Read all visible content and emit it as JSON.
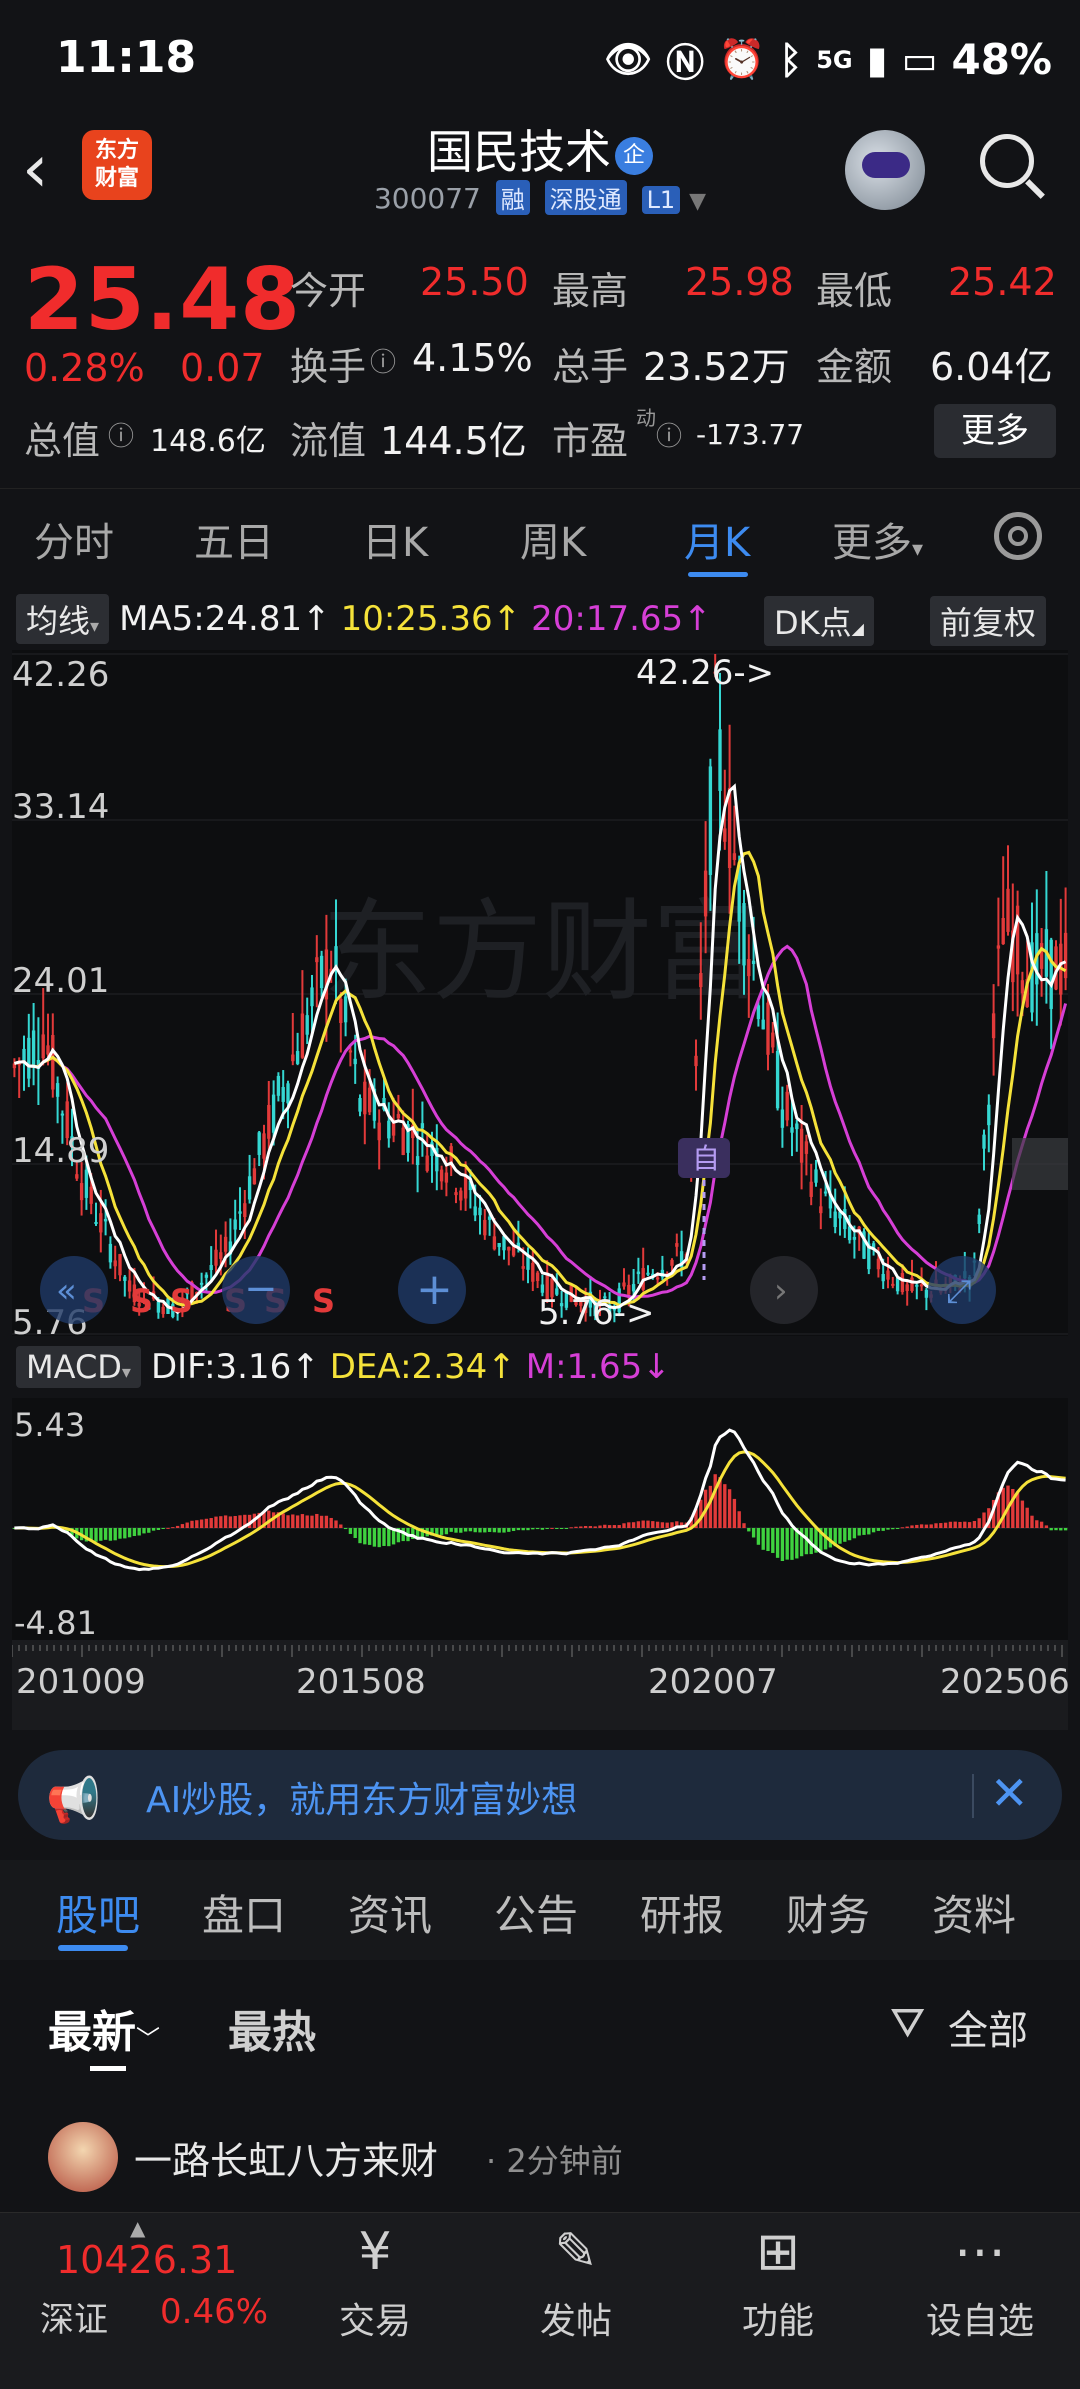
{
  "status_bar": {
    "time": "11:18",
    "network": "5G",
    "battery": "48%"
  },
  "header": {
    "logo_text": "东方财富",
    "stock_name": "国民技术",
    "qi_badge": "企",
    "stock_code": "300077",
    "tags": [
      "融",
      "深股通",
      "L1"
    ]
  },
  "quote": {
    "price": "25.48",
    "change_pct": "0.28%",
    "change": "0.07",
    "fields": [
      {
        "label": "今开",
        "value": "25.50",
        "color": "#f02c2c"
      },
      {
        "label": "最高",
        "value": "25.98",
        "color": "#f02c2c"
      },
      {
        "label": "最低",
        "value": "25.42",
        "color": "#f02c2c"
      },
      {
        "label": "换手",
        "value": "4.15%",
        "color": "#f2f2f2"
      },
      {
        "label": "总手",
        "value": "23.52万",
        "color": "#f2f2f2"
      },
      {
        "label": "金额",
        "value": "6.04亿",
        "color": "#f2f2f2"
      },
      {
        "label": "总值",
        "value": "148.6亿",
        "color": "#f2f2f2"
      },
      {
        "label": "流值",
        "value": "144.5亿",
        "color": "#f2f2f2"
      },
      {
        "label": "市盈",
        "value": "-173.77",
        "color": "#f2f2f2"
      }
    ],
    "pe_suffix": "动",
    "more_label": "更多"
  },
  "period_tabs": [
    "分时",
    "五日",
    "日K",
    "周K",
    "月K",
    "更多"
  ],
  "active_period": "月K",
  "ma_row": {
    "label": "均线",
    "ma5": "MA5:24.81↑",
    "ma10": "10:25.36↑",
    "ma20": "20:17.65↑",
    "dk_label": "DK点",
    "fq_label": "前复权"
  },
  "kline": {
    "y_ticks": [
      "42.26",
      "33.14",
      "24.01",
      "14.89",
      "5.76"
    ],
    "max_label": "42.26->",
    "min_label": "5.76->",
    "self_marker": "自",
    "s_marker": "S",
    "watermark": "东方财富",
    "colors": {
      "up": "#e23a3a",
      "down": "#35d7d2",
      "ma5": "#ffffff",
      "ma10": "#f5e23a",
      "ma20": "#d63fd6"
    }
  },
  "macd": {
    "label": "MACD",
    "dif": "DIF:3.16↑",
    "dea": "DEA:2.34↑",
    "m": "M:1.65↓",
    "y_ticks": [
      "5.43",
      "-4.81"
    ]
  },
  "x_axis": [
    "201009",
    "201508",
    "202007",
    "202506"
  ],
  "ai_banner": "AI炒股，就用东方财富妙想",
  "bottom_tabs": [
    "股吧",
    "盘口",
    "资讯",
    "公告",
    "研报",
    "财务",
    "资料"
  ],
  "filter": {
    "latest": "最新",
    "hot": "最热",
    "all": "全部"
  },
  "post": {
    "user": "一路长虹八方来财",
    "time": "· 2分钟前"
  },
  "bottom_nav": {
    "index_value": "10426.31",
    "index_name": "深证",
    "index_pct": "0.46%",
    "items": [
      "交易",
      "发帖",
      "功能",
      "设自选"
    ]
  }
}
